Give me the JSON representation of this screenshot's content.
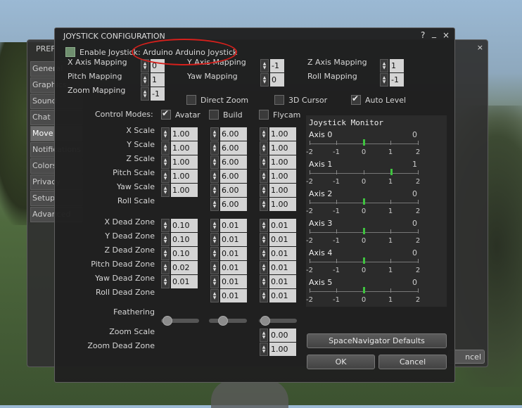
{
  "preferences": {
    "title": "PREF",
    "close": "×",
    "tabs": [
      "General",
      "Graphics",
      "Sound",
      "Chat",
      "Move",
      "Notifications",
      "Colors",
      "Privacy",
      "Setup",
      "Advanced"
    ],
    "selected_tab": "Move",
    "cancel_label": "ncel"
  },
  "dialog": {
    "title": "JOYSTICK CONFIGURATION",
    "help": "?",
    "minimize": "_",
    "close": "×",
    "enable_label": "Enable Joystick: Arduino Arduino Joystick",
    "mappings": [
      {
        "label": "X Axis Mapping",
        "value": "0"
      },
      {
        "label": "Y Axis Mapping",
        "value": "-1"
      },
      {
        "label": "Z Axis Mapping",
        "value": "1"
      },
      {
        "label": "Pitch Mapping",
        "value": "1"
      },
      {
        "label": "Yaw Mapping",
        "value": "0"
      },
      {
        "label": "Roll Mapping",
        "value": "-1"
      },
      {
        "label": "Zoom Mapping",
        "value": "-1"
      }
    ],
    "checkboxes": {
      "direct_zoom": {
        "label": "Direct Zoom",
        "checked": false
      },
      "cursor_3d": {
        "label": "3D Cursor",
        "checked": false
      },
      "auto_level": {
        "label": "Auto Level",
        "checked": true
      }
    },
    "control_modes": {
      "label": "Control Modes:",
      "avatar": {
        "label": "Avatar",
        "checked": true
      },
      "build": {
        "label": "Build",
        "checked": false
      },
      "flycam": {
        "label": "Flycam",
        "checked": false
      }
    },
    "scales": {
      "rows": [
        "X Scale",
        "Y Scale",
        "Z Scale",
        "Pitch Scale",
        "Yaw Scale",
        "Roll Scale"
      ],
      "avatar": [
        "1.00",
        "1.00",
        "1.00",
        "1.00",
        "1.00",
        ""
      ],
      "build": [
        "6.00",
        "6.00",
        "6.00",
        "6.00",
        "6.00",
        "6.00"
      ],
      "flycam": [
        "1.00",
        "1.00",
        "1.00",
        "1.00",
        "1.00",
        "1.00"
      ]
    },
    "dead_zones": {
      "rows": [
        "X Dead Zone",
        "Y Dead Zone",
        "Z Dead Zone",
        "Pitch Dead Zone",
        "Yaw Dead Zone",
        "Roll Dead Zone"
      ],
      "avatar": [
        "0.10",
        "0.10",
        "0.10",
        "0.02",
        "0.01",
        ""
      ],
      "build": [
        "0.01",
        "0.01",
        "0.01",
        "0.01",
        "0.01",
        "0.01"
      ],
      "flycam": [
        "0.01",
        "0.01",
        "0.01",
        "0.01",
        "0.01",
        "0.01"
      ]
    },
    "feathering": {
      "label": "Feathering",
      "avatar": 0.05,
      "build": 0.3,
      "flycam": 0.05
    },
    "zoom": {
      "scale_label": "Zoom Scale",
      "scale_value": "0.00",
      "dead_label": "Zoom Dead Zone",
      "dead_value": "1.00"
    },
    "monitor": {
      "title": "Joystick Monitor",
      "tick_labels": [
        "-2",
        "-1",
        "0",
        "1",
        "2"
      ],
      "axes": [
        {
          "name": "Axis 0",
          "value": "0",
          "level": 0
        },
        {
          "name": "Axis 1",
          "value": "1",
          "level": 1
        },
        {
          "name": "Axis 2",
          "value": "0",
          "level": 0
        },
        {
          "name": "Axis 3",
          "value": "0",
          "level": 0
        },
        {
          "name": "Axis 4",
          "value": "0",
          "level": 0
        },
        {
          "name": "Axis 5",
          "value": "0",
          "level": 0
        }
      ]
    },
    "spacenav_label": "SpaceNavigator Defaults",
    "ok_label": "OK",
    "cancel_label": "Cancel"
  },
  "colors": {
    "highlight_ring": "#d6201c",
    "axis_bar": "#3fc33f"
  }
}
